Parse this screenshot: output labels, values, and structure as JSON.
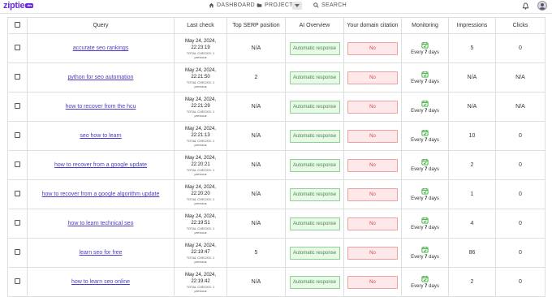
{
  "brand": {
    "name": "ziptie",
    "badge": "dev"
  },
  "nav": {
    "dashboard": "DASHBOARD",
    "projects": "PROJECTS",
    "search": "SEARCH"
  },
  "colors": {
    "accent": "#6a2bd9",
    "link": "#4a3cc9",
    "positive": "#3d8f3d",
    "negative": "#d94444"
  },
  "table": {
    "headers": [
      "Query",
      "Last check",
      "Top SERP position",
      "AI Overview",
      "Your domain citation",
      "Monitoring",
      "Impressions",
      "Clicks"
    ],
    "total_checks_label": "TOTAL CHECKS: 1",
    "previous_label": "previous",
    "every_label": "Every",
    "days_label": "days",
    "rows": [
      {
        "query": "accurate seo rankings",
        "date": "May 24, 2024,",
        "time": "22:23:19",
        "serp": "N/A",
        "ai": "Automatic response",
        "citation": "No",
        "every": "7",
        "impressions": "5",
        "clicks": "0"
      },
      {
        "query": "python for seo automation",
        "date": "May 24, 2024,",
        "time": "22:21:50",
        "serp": "2",
        "ai": "Automatic response",
        "citation": "No",
        "every": "7",
        "impressions": "N/A",
        "clicks": "N/A"
      },
      {
        "query": "how to recover from the hcu",
        "date": "May 24, 2024,",
        "time": "22:21:29",
        "serp": "N/A",
        "ai": "Automatic response",
        "citation": "No",
        "every": "7",
        "impressions": "N/A",
        "clicks": "N/A"
      },
      {
        "query": "seo how to learn",
        "date": "May 24, 2024,",
        "time": "22:21:13",
        "serp": "N/A",
        "ai": "Automatic response",
        "citation": "No",
        "every": "7",
        "impressions": "10",
        "clicks": "0"
      },
      {
        "query": "how to recover from a google update",
        "date": "May 24, 2024,",
        "time": "22:20:21",
        "serp": "N/A",
        "ai": "Automatic response",
        "citation": "No",
        "every": "7",
        "impressions": "2",
        "clicks": "0"
      },
      {
        "query": "how to recover from a google algorithm update",
        "date": "May 24, 2024,",
        "time": "22:20:20",
        "serp": "N/A",
        "ai": "Automatic response",
        "citation": "No",
        "every": "7",
        "impressions": "1",
        "clicks": "0"
      },
      {
        "query": "how to learn technical seo",
        "date": "May 24, 2024,",
        "time": "22:19:51",
        "serp": "N/A",
        "ai": "Automatic response",
        "citation": "No",
        "every": "7",
        "impressions": "4",
        "clicks": "0"
      },
      {
        "query": "learn seo for free",
        "date": "May 24, 2024,",
        "time": "22:19:47",
        "serp": "5",
        "ai": "Automatic response",
        "citation": "No",
        "every": "7",
        "impressions": "86",
        "clicks": "0"
      },
      {
        "query": "how to learn seo online",
        "date": "May 24, 2024,",
        "time": "22:19:42",
        "serp": "N/A",
        "ai": "Automatic response",
        "citation": "No",
        "every": "7",
        "impressions": "2",
        "clicks": "0"
      }
    ]
  }
}
